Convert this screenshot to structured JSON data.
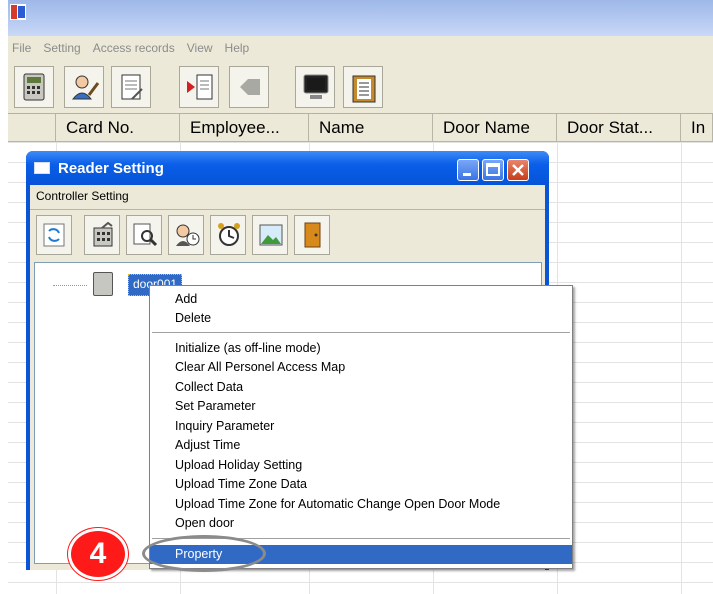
{
  "menu": [
    "File",
    "Setting",
    "Access records",
    "View",
    "Help"
  ],
  "toolbar_icons": [
    "controller-icon",
    "user-edit-icon",
    "report-icon",
    "import-icon",
    "card-icon",
    "monitor-icon",
    "clipboard-icon"
  ],
  "grid": {
    "columns": [
      "",
      "Card No.",
      "Employee...",
      "Name",
      "Door Name",
      "Door Stat...",
      "In"
    ]
  },
  "dialog": {
    "title": "Reader Setting",
    "menu_label": "Controller Setting",
    "toolbar_icons": [
      "refresh-icon",
      "controller-icon",
      "search-icon",
      "user-clock-icon",
      "alarm-clock-icon",
      "image-icon",
      "door-icon"
    ],
    "tree_item": "door001"
  },
  "context_menu": {
    "group1": [
      "Add",
      "Delete"
    ],
    "group2": [
      "Initialize (as off-line mode)",
      "Clear All Personel Access Map",
      "Collect Data",
      "Set Parameter",
      "Inquiry Parameter",
      "Adjust Time",
      "Upload Holiday Setting",
      "Upload Time Zone Data",
      "Upload Time Zone for  Automatic Change Open Door Mode",
      "Open door"
    ],
    "group3": [
      "Property"
    ],
    "selected": "Property"
  },
  "step_badge": "4",
  "colors": {
    "accent": "#316ac5",
    "step_badge": "#ff1a1a",
    "title_blue": "#0a5ee8"
  }
}
